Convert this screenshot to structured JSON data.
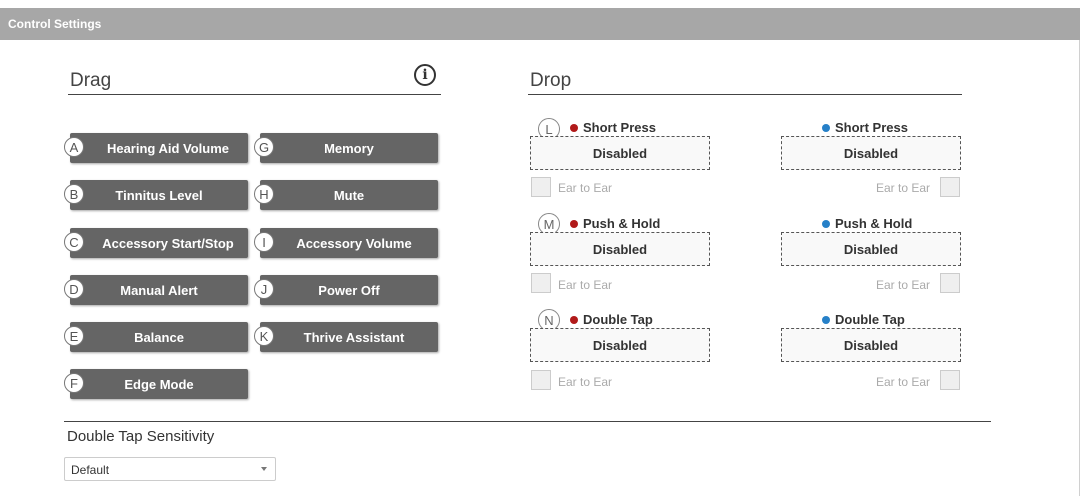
{
  "window": {
    "title": "Control Settings"
  },
  "drag": {
    "heading": "Drag",
    "info_icon": "info-icon",
    "items": [
      {
        "letter": "A",
        "label": "Hearing Aid Volume"
      },
      {
        "letter": "B",
        "label": "Tinnitus Level"
      },
      {
        "letter": "C",
        "label": "Accessory Start/Stop"
      },
      {
        "letter": "D",
        "label": "Manual Alert"
      },
      {
        "letter": "E",
        "label": "Balance"
      },
      {
        "letter": "F",
        "label": "Edge Mode"
      },
      {
        "letter": "G",
        "label": "Memory"
      },
      {
        "letter": "H",
        "label": "Mute"
      },
      {
        "letter": "I",
        "label": "Accessory Volume"
      },
      {
        "letter": "J",
        "label": "Power Off"
      },
      {
        "letter": "K",
        "label": "Thrive Assistant"
      }
    ]
  },
  "drop": {
    "heading": "Drop",
    "colors": {
      "left": "#b11a1a",
      "right": "#2680c8"
    },
    "rows": [
      {
        "letter": "L",
        "left_label": "Short Press",
        "right_label": "Short Press",
        "left_value": "Disabled",
        "right_value": "Disabled",
        "ear_to_ear_left": "Ear to Ear",
        "ear_to_ear_right": "Ear to Ear"
      },
      {
        "letter": "M",
        "left_label": "Push & Hold",
        "right_label": "Push & Hold",
        "left_value": "Disabled",
        "right_value": "Disabled",
        "ear_to_ear_left": "Ear to Ear",
        "ear_to_ear_right": "Ear to Ear"
      },
      {
        "letter": "N",
        "left_label": "Double Tap",
        "right_label": "Double Tap",
        "left_value": "Disabled",
        "right_value": "Disabled",
        "ear_to_ear_left": "Ear to Ear",
        "ear_to_ear_right": "Ear to Ear"
      }
    ]
  },
  "sensitivity": {
    "label": "Double Tap Sensitivity",
    "selected": "Default"
  }
}
